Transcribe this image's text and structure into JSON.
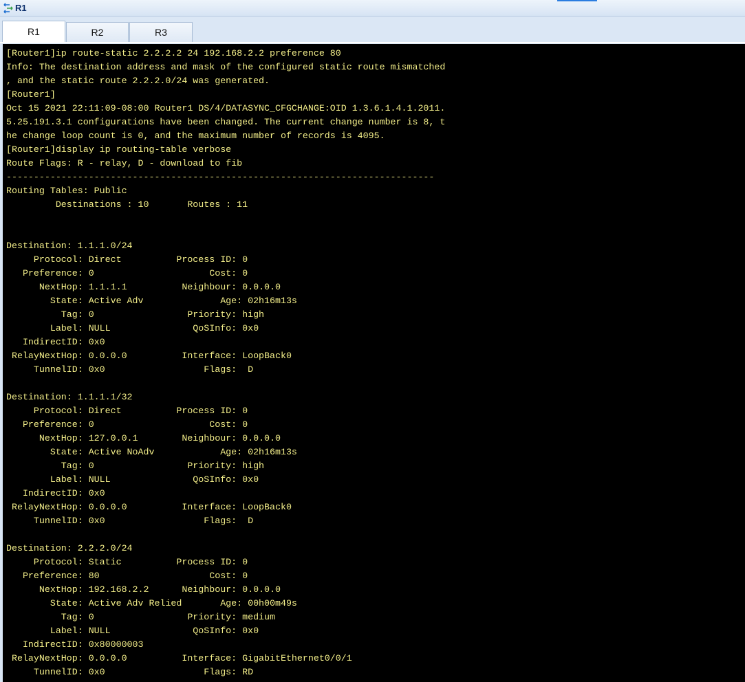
{
  "window": {
    "title": "R1",
    "title_icon": "network-device-icon",
    "accent_color": "#2b7de0"
  },
  "tabs": [
    {
      "label": "R1",
      "active": true
    },
    {
      "label": "R2",
      "active": false
    },
    {
      "label": "R3",
      "active": false
    }
  ],
  "terminal": {
    "background": "#000000",
    "text_color": "#f4ef8a",
    "lines": [
      "[Router1]ip route-static 2.2.2.2 24 192.168.2.2 preference 80",
      "Info: The destination address and mask of the configured static route mismatched",
      ", and the static route 2.2.2.0/24 was generated.",
      "[Router1]",
      "Oct 15 2021 22:11:09-08:00 Router1 DS/4/DATASYNC_CFGCHANGE:OID 1.3.6.1.4.1.2011.",
      "5.25.191.3.1 configurations have been changed. The current change number is 8, t",
      "he change loop count is 0, and the maximum number of records is 4095.",
      "[Router1]display ip routing-table verbose",
      "Route Flags: R - relay, D - download to fib",
      "------------------------------------------------------------------------------",
      "Routing Tables: Public",
      "         Destinations : 10       Routes : 11",
      "",
      "",
      "Destination: 1.1.1.0/24",
      "     Protocol: Direct          Process ID: 0",
      "   Preference: 0                     Cost: 0",
      "      NextHop: 1.1.1.1          Neighbour: 0.0.0.0",
      "        State: Active Adv              Age: 02h16m13s",
      "          Tag: 0                 Priority: high",
      "        Label: NULL               QoSInfo: 0x0",
      "   IndirectID: 0x0",
      " RelayNextHop: 0.0.0.0          Interface: LoopBack0",
      "     TunnelID: 0x0                  Flags:  D",
      "",
      "Destination: 1.1.1.1/32",
      "     Protocol: Direct          Process ID: 0",
      "   Preference: 0                     Cost: 0",
      "      NextHop: 127.0.0.1        Neighbour: 0.0.0.0",
      "        State: Active NoAdv            Age: 02h16m13s",
      "          Tag: 0                 Priority: high",
      "        Label: NULL               QoSInfo: 0x0",
      "   IndirectID: 0x0",
      " RelayNextHop: 0.0.0.0          Interface: LoopBack0",
      "     TunnelID: 0x0                  Flags:  D",
      "",
      "Destination: 2.2.2.0/24",
      "     Protocol: Static          Process ID: 0",
      "   Preference: 80                    Cost: 0",
      "      NextHop: 192.168.2.2      Neighbour: 0.0.0.0",
      "        State: Active Adv Relied       Age: 00h00m49s",
      "          Tag: 0                 Priority: medium",
      "        Label: NULL               QoSInfo: 0x0",
      "   IndirectID: 0x80000003",
      " RelayNextHop: 0.0.0.0          Interface: GigabitEthernet0/0/1",
      "     TunnelID: 0x0                  Flags: RD"
    ]
  }
}
